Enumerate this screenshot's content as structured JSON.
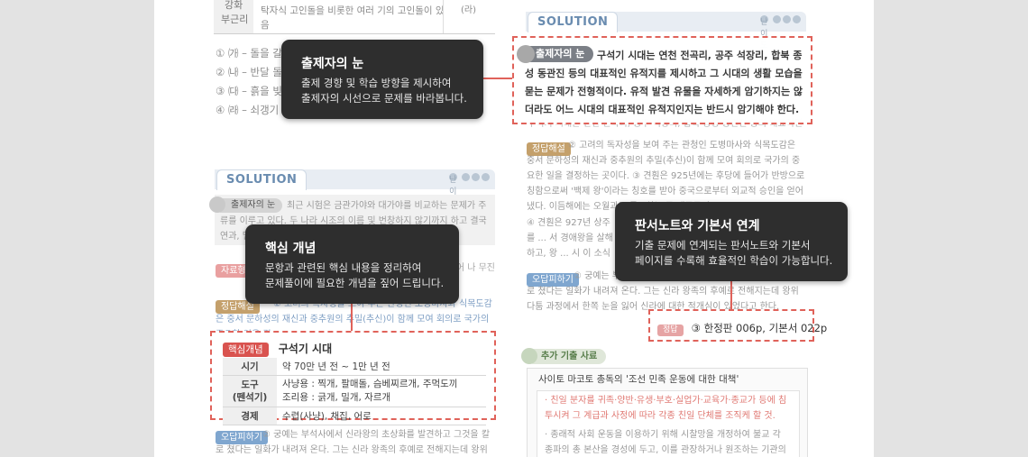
{
  "left_column": {
    "top_table": {
      "label_1": "강화",
      "label_2": "부근리",
      "text_1": "탁자식 고인돌을 비롯한 여러 기의 고인돌이 있",
      "text_2": "음",
      "option": "(라)"
    },
    "choices": [
      "① ㈎ – 돌을 갈",
      "② ㈏ – 반달 돌",
      "③ ㈐ – 흙을 빚",
      "④ ㈑ – 쇠갱기"
    ],
    "solution_tab": "SOLUTION",
    "difficulty": "난이도",
    "examiner_badge": "출제자의 눈",
    "examiner_text": "최근 시험은 금관가야와 대가야를 비교하는 문제가 주류를 이루고 있다. 두 나라 시조의 이름 및 번창하지 않기까지 하고 결국연과, 멸해 중도 시기, 유적지(고분) 등...",
    "explain_label": "자료형",
    "answer_label": "정답해설",
    "answer_text": "② 고려의 독자성을 보여 주는 관청인 도병마사와 식목도감은 중서 문하성의 재신과 중추원의 추밀(추신)이 함께 모여 회의로 국가의 중요한 일을 결",
    "side_text": "들고 있어 나 무진",
    "keyconcept": {
      "badge": "핵심개념",
      "title": "구석기 시대",
      "rows": [
        {
          "head": "시기",
          "value": "약 70만 년 전 ~ 1만 년 전"
        },
        {
          "head": "도구\n(뗀석기)",
          "value": "사냥용 : 찍개, 팔매돌, 슴베찌르개, 주먹도끼\n조리용 : 긁개, 밀개, 자르개"
        },
        {
          "head": "경제",
          "value": "수렵(사냥), 채집, 어로"
        }
      ]
    },
    "wrong_label": "오답피하기",
    "wrong_text": "② 궁예는 부석사에서 신라왕의 초상화를 발견하고 그것을 칼로 쳤다는 일화가 내려져 온다. 그는 신라 왕족의 후예로 전해지는데 왕위 다툼 과정에"
  },
  "right_column": {
    "solution_tab": "SOLUTION",
    "difficulty": "난이도",
    "examiner_badge": "출제자의 눈",
    "examiner_text": "구석기 시대는 연천 전곡리, 공주 석장리, 합북 종성 동관진 등의 대표적인 유적지를 제시하고 그 시대의 생활 모습을 묻는 문제가 전형적이다. 유적 발견 유물을 자세하게 암기하지는 않더라도 어느 시대의 대표적인 유적지인지는 반드시 암기해야 한다.",
    "answer_label": "정답해설",
    "answer_text": "② 고려의 독자성을 보여 주는 관청인 도병마사와 식목도감은 중서 문하성의 재신과 중추원의 추밀(추신)이 함께 모여 회의로 국가의 중요한 일을 결정하는 곳이다. ③ 견훤은 925년에는 후당에 들어가 반방으로 칭함으로써 '백제 왕'이라는 칭호를 받아 중국으로부터 외교적 승인을 얻어냈다. 이듬해에는 오월과도 통교하는 등 대중국외교...",
    "answer_text_2": "④ 견훤은 927년 상주를 ... 서 경애왕을 살해하고, 왕 ... 시 이 소식을 듣고 운 왕건",
    "wrong_label": "오답피하기",
    "wrong_text": "② 궁예는 부석사에서 신라왕의 초상화를 발견하고 그것을 칼로 쳤다는 일화가 내려져 온다. 그는 신라 왕족의 후예로 전해지는데 왕위 다툼 과정에서 한쪽 눈을 잃어 신라에 대한 적개심이 있었다고 한다.",
    "answer_box": {
      "badge": "정답",
      "text": "③ 한정판 006p, 기본서 022p"
    },
    "extra": {
      "label": "추가 기출 사료",
      "title": "사이토 마코토 총독의 '조선 민족 운동에 대한 대책'",
      "items": [
        "· 친일 분자를 귀족·양반·유생·부호·실업가·교육가·종교가 등에 침투시켜 그 계급과 사정에 따라 각종 친일 단체를 조직케 할 것.",
        "· 종래적 사회 운동을 이용하기 위해 시찰망을 개정하여 불교 각 종파의 총 본산을 경성에 두고, 이를 관장하거나 원조하는 기관의 회장에 친일"
      ]
    }
  },
  "tooltips": [
    {
      "title": "출제자의 눈",
      "desc": "출제 경향 및 학습 방향을 제시하여\n출제자의 시선으로 문제를 바라봅니다."
    },
    {
      "title": "핵심 개념",
      "desc": "문항과 관련된 핵심 내용을 정리하여\n문제풀이에 필요한 개념을 짚어 드립니다."
    },
    {
      "title": "판서노트와 기본서 연계",
      "desc": "기출 문제에 연계되는 판서노트와 기본서\n페이지를 수록해 효율적인 학습이 가능합니다."
    }
  ],
  "colors": {
    "accent_red": "#e0625a",
    "tooltip_bg": "#2e2e2e",
    "solution_blue": "#6a8cb0"
  }
}
